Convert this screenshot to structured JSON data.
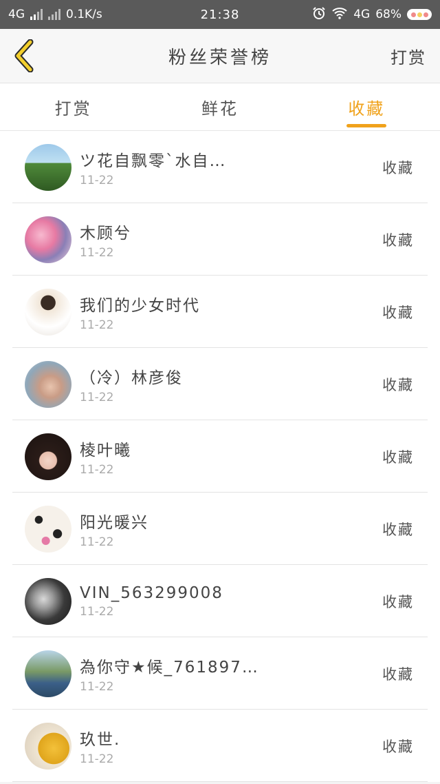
{
  "status_bar": {
    "network_left": "4G",
    "speed": "0.1K/s",
    "time": "21:38",
    "network_right": "4G",
    "battery": "68%"
  },
  "header": {
    "title": "粉丝荣誉榜",
    "action": "打赏"
  },
  "tabs": [
    {
      "label": "打赏",
      "active": false
    },
    {
      "label": "鲜花",
      "active": false
    },
    {
      "label": "收藏",
      "active": true
    }
  ],
  "colors": {
    "accent": "#f0a21b",
    "statusbar": "#5a5a5a"
  },
  "fans": [
    {
      "name": "ツ花自飘零`水自…",
      "date": "11-22",
      "action": "收藏"
    },
    {
      "name": "木顾兮",
      "date": "11-22",
      "action": "收藏"
    },
    {
      "name": "我们的少女时代",
      "date": "11-22",
      "action": "收藏"
    },
    {
      "name": "（冷）林彦俊",
      "date": "11-22",
      "action": "收藏"
    },
    {
      "name": "棱叶曦",
      "date": "11-22",
      "action": "收藏"
    },
    {
      "name": "阳光暖兴",
      "date": "11-22",
      "action": "收藏"
    },
    {
      "name": "VIN_563299008",
      "date": "11-22",
      "action": "收藏"
    },
    {
      "name": "為你守★候_761897…",
      "date": "11-22",
      "action": "收藏"
    },
    {
      "name": "玖世.",
      "date": "11-22",
      "action": "收藏"
    }
  ]
}
